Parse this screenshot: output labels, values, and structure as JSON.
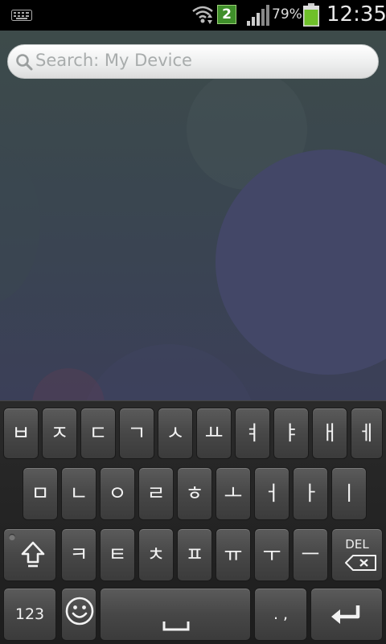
{
  "status_bar": {
    "notification_count": "2",
    "battery_percent": "79%",
    "time": "12:35"
  },
  "search": {
    "placeholder": "Search: My Device"
  },
  "keyboard": {
    "row1": [
      "ㅂ",
      "ㅈ",
      "ㄷ",
      "ㄱ",
      "ㅅ",
      "ㅛ",
      "ㅕ",
      "ㅑ",
      "ㅐ",
      "ㅔ"
    ],
    "row2": [
      "ㅁ",
      "ㄴ",
      "ㅇ",
      "ㄹ",
      "ㅎ",
      "ㅗ",
      "ㅓ",
      "ㅏ",
      "ㅣ"
    ],
    "row3": [
      "ㅋ",
      "ㅌ",
      "ㅊ",
      "ㅍ",
      "ㅠ",
      "ㅜ",
      "ㅡ"
    ],
    "delete_label": "DEL",
    "numbers_label": "123",
    "punctuation_label": ". ,"
  }
}
